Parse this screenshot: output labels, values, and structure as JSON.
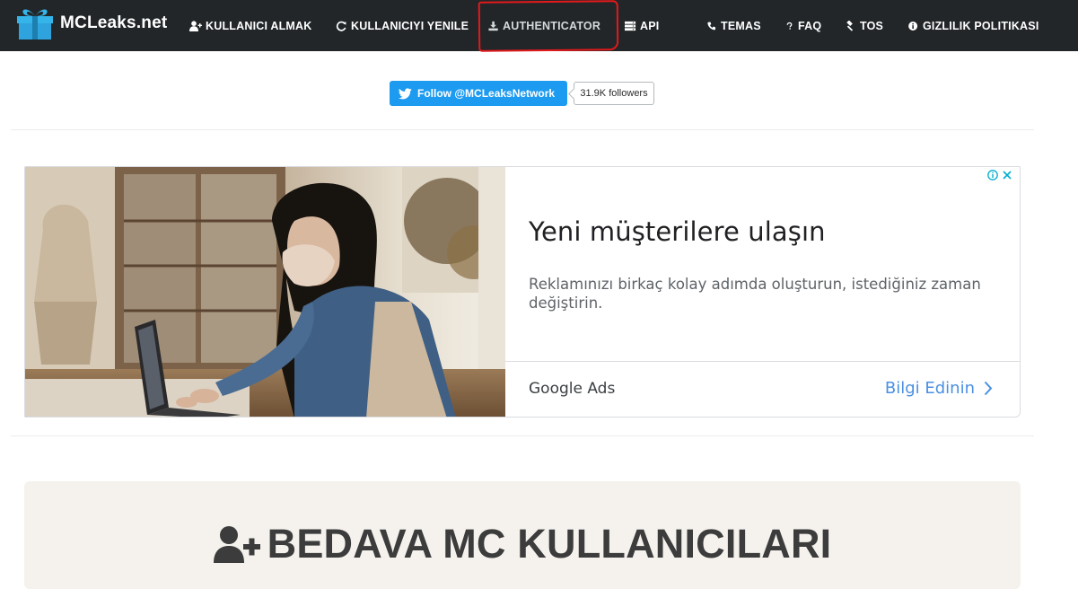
{
  "navbar": {
    "brand": "MCLeaks.net",
    "items": [
      {
        "label": "KULLANICI ALMAK",
        "icon": "user-plus-icon"
      },
      {
        "label": "KULLANICIYI YENILE",
        "icon": "refresh-icon"
      },
      {
        "label": "AUTHENTICATOR",
        "icon": "download-icon"
      },
      {
        "label": "API",
        "icon": "server-icon"
      },
      {
        "label": "TEMAS",
        "icon": "phone-icon"
      },
      {
        "label": "FAQ",
        "icon": "question-icon"
      },
      {
        "label": "TOS",
        "icon": "gavel-icon"
      },
      {
        "label": "GIZLILIK POLITIKASI",
        "icon": "info-circle-icon"
      }
    ],
    "highlighted_item": "AUTHENTICATOR",
    "highlight_color": "#e3191b"
  },
  "twitter": {
    "follow_label": "Follow @MCLeaksNetwork",
    "followers": "31.9K followers",
    "color": "#1d9bf0"
  },
  "ad": {
    "headline": "Yeni müşterilere ulaşın",
    "body": "Reklamınızı birkaç kolay adımda oluşturun, istediğiniz zaman değiştirin.",
    "advertiser": "Google Ads",
    "cta": "Bilgi Edinin",
    "cta_color": "#4a90e2"
  },
  "panel": {
    "title": "BEDAVA MC KULLANICILARI",
    "icon": "user-plus-icon"
  },
  "colors": {
    "navbar_bg": "#222629",
    "panel_bg": "#f5f2ee",
    "gift_logo": "#2ea3dd"
  }
}
